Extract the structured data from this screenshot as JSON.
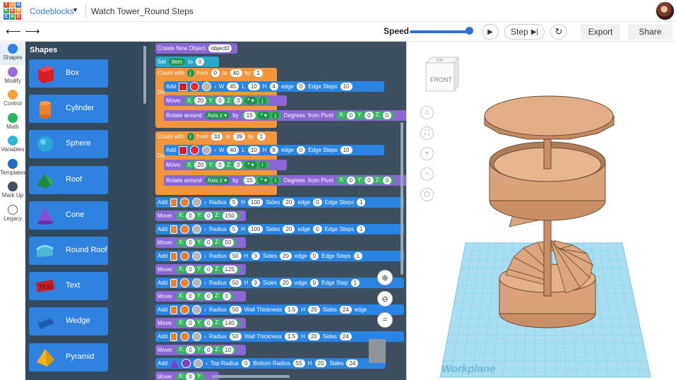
{
  "topbar": {
    "logo_letters": [
      "T",
      "I",
      "N",
      "K",
      "E",
      "R",
      "C",
      "A",
      "D"
    ],
    "app_name": "Codeblocks",
    "doc_title": "Watch Tower_Round Steps"
  },
  "toolbar": {
    "speed_label": "Speed",
    "speed_value_fraction": 0.9,
    "step_label": "Step",
    "export_label": "Export",
    "share_label": "Share"
  },
  "categories": [
    {
      "label": "Shapes",
      "color": "#2f82e0"
    },
    {
      "label": "Modify",
      "color": "#9a6ee0"
    },
    {
      "label": "Control",
      "color": "#f7a23d"
    },
    {
      "label": "Math",
      "color": "#2ab55e"
    },
    {
      "label": "Variables",
      "color": "#2bb5d8"
    },
    {
      "label": "Templates",
      "color": "#1f6fc0"
    },
    {
      "label": "Mark Up",
      "color": "#44525e"
    },
    {
      "label": "Legacy",
      "color": "#ffffff"
    }
  ],
  "shapes_panel": {
    "title": "Shapes",
    "items": [
      "Box",
      "Cylinder",
      "Sphere",
      "Roof",
      "Cone",
      "Round Roof",
      "Text",
      "Wedge",
      "Pyramid"
    ]
  },
  "code": {
    "create_label": "Create New Object",
    "create_var": "object0",
    "set_label": "Set",
    "set_var": "item",
    "set_to": "to",
    "set_value": "0",
    "do_label": "Do",
    "loop1": {
      "label": "Count with",
      "var": "j",
      "from": "from",
      "from_val": "0",
      "to": "to",
      "to_val": "40",
      "by": "by",
      "by_val": "1"
    },
    "loop1_add": {
      "add": "Add",
      "w": "W",
      "w_val": "45",
      "l": "L",
      "l_val": "10",
      "h": "H",
      "h_val": "4",
      "edge": "edge",
      "edge_val": "0",
      "edge_steps": "Edge Steps",
      "edge_steps_val": "10"
    },
    "loop1_move": {
      "label": "Move:",
      "x": "X:",
      "x_val": "20",
      "y": "Y:",
      "y_val": "0",
      "z": "Z:",
      "z_val": "3",
      "op": "* ▾",
      "var": "j"
    },
    "loop1_rotate": {
      "label": "Rotate around",
      "axis": "Axis z ▾",
      "by": "by",
      "by_val": "15",
      "op": "* ▾",
      "var": "j",
      "deg": "Degrees",
      "pivot": "from Pivot",
      "x": "X:",
      "x_val": "0",
      "y": "Y:",
      "y_val": "0",
      "z": "Z:",
      "z_val": "0"
    },
    "loop2": {
      "label": "Count with",
      "var": "i",
      "from": "from",
      "from_val": "33",
      "to": "to",
      "to_val": "39",
      "by": "by",
      "by_val": "1"
    },
    "loop2_add": {
      "add": "Add",
      "w": "W",
      "w_val": "40",
      "l": "L",
      "l_val": "10",
      "h": "H",
      "h_val": "8",
      "edge": "edge",
      "edge_val": "0",
      "edge_steps": "Edge Steps",
      "edge_steps_val": "10"
    },
    "loop2_move": {
      "label": "Move:",
      "x": "X:",
      "x_val": "20",
      "y": "Y:",
      "y_val": "0",
      "z": "Z:",
      "z_val": "3",
      "op": "* ▾",
      "var": "i"
    },
    "loop2_rotate": {
      "label": "Rotate around",
      "axis": "Axis z ▾",
      "by": "by",
      "by_val": "15",
      "op": "* ▾",
      "var": "i",
      "deg": "Degrees",
      "pivot": "from Pivot",
      "x": "X:",
      "x_val": "0",
      "y": "Y:",
      "y_val": "0",
      "z": "Z:",
      "z_val": "0"
    },
    "adds": [
      {
        "add": "Add",
        "kind": "radius",
        "radius": "Radius",
        "radius_val": "5",
        "h": "H",
        "h_val": "100",
        "sides": "Sides",
        "sides_val": "20",
        "edge": "edge",
        "edge_val": "0",
        "edge_steps": "Edge Steps",
        "edge_steps_val": "1",
        "move": {
          "label": "Move:",
          "x": "X:",
          "x_val": "0",
          "y": "Y:",
          "y_val": "0",
          "z": "Z:",
          "z_val": "150"
        }
      },
      {
        "add": "Add",
        "kind": "radius",
        "radius": "Radius",
        "radius_val": "5",
        "h": "H",
        "h_val": "100",
        "sides": "Sides",
        "sides_val": "20",
        "edge": "edge",
        "edge_val": "0",
        "edge_steps": "Edge Steps",
        "edge_steps_val": "1",
        "move": {
          "label": "Move:",
          "x": "X:",
          "x_val": "0",
          "y": "Y:",
          "y_val": "0",
          "z": "Z:",
          "z_val": "50"
        }
      },
      {
        "add": "Add",
        "kind": "radius",
        "radius": "Radius",
        "radius_val": "50",
        "h": "H",
        "h_val": "3",
        "sides": "Sides",
        "sides_val": "20",
        "edge": "edge",
        "edge_val": "0",
        "edge_steps": "Edge Steps",
        "edge_steps_val": "1",
        "move": {
          "label": "Move:",
          "x": "X:",
          "x_val": "0",
          "y": "Y:",
          "y_val": "0",
          "z": "Z:",
          "z_val": "125"
        }
      },
      {
        "add": "Add",
        "kind": "radius",
        "radius": "Radius",
        "radius_val": "50",
        "h": "H",
        "h_val": "3",
        "sides": "Sides",
        "sides_val": "20",
        "edge": "edge",
        "edge_val": "0",
        "edge_steps": "Edge Step",
        "edge_steps_val": "1",
        "move": {
          "label": "Move:",
          "x": "X:",
          "x_val": "0",
          "y": "Y:",
          "y_val": "0",
          "z": "Z:",
          "z_val": "0"
        }
      },
      {
        "add": "Add",
        "kind": "tube",
        "radius": "Radius",
        "radius_val": "50",
        "h": "Wall Thickness",
        "h_val": "1.5",
        "sides": "H",
        "sides_val": "20",
        "edge": "Sides",
        "edge_val": "24",
        "edge_steps": "edge",
        "edge_steps_val": "",
        "move": {
          "label": "Move:",
          "x": "X:",
          "x_val": "0",
          "y": "Y:",
          "y_val": "0",
          "z": "Z:",
          "z_val": "140"
        }
      },
      {
        "add": "Add",
        "kind": "tube",
        "radius": "Radius",
        "radius_val": "50",
        "h": "Wall Thickness",
        "h_val": "1.5",
        "sides": "H",
        "sides_val": "20",
        "edge": "Sides",
        "edge_val": "24",
        "edge_steps": "",
        "edge_steps_val": "",
        "move": {
          "label": "Move:",
          "x": "X:",
          "x_val": "0",
          "y": "Y:",
          "y_val": "0",
          "z": "Z:",
          "z_val": "10"
        }
      }
    ],
    "cone_add": {
      "add": "Add",
      "top": "Top Radius",
      "top_val": "0",
      "bottom": "Bottom Radius",
      "bottom_val": "55",
      "h": "H",
      "h_val": "20",
      "sides": "Sides",
      "sides_val": "24"
    },
    "last_move": {
      "label": "Move:",
      "x": "X:",
      "x_val": "0",
      "y": "Y:"
    }
  },
  "viewport": {
    "viewcube_top": "TOP",
    "viewcube_front": "FRONT",
    "workplane_label": "Workplane"
  },
  "colors": {
    "accent": "#2f82e0",
    "tower": "#d9a27a",
    "workplane": "#9fdcf2"
  }
}
